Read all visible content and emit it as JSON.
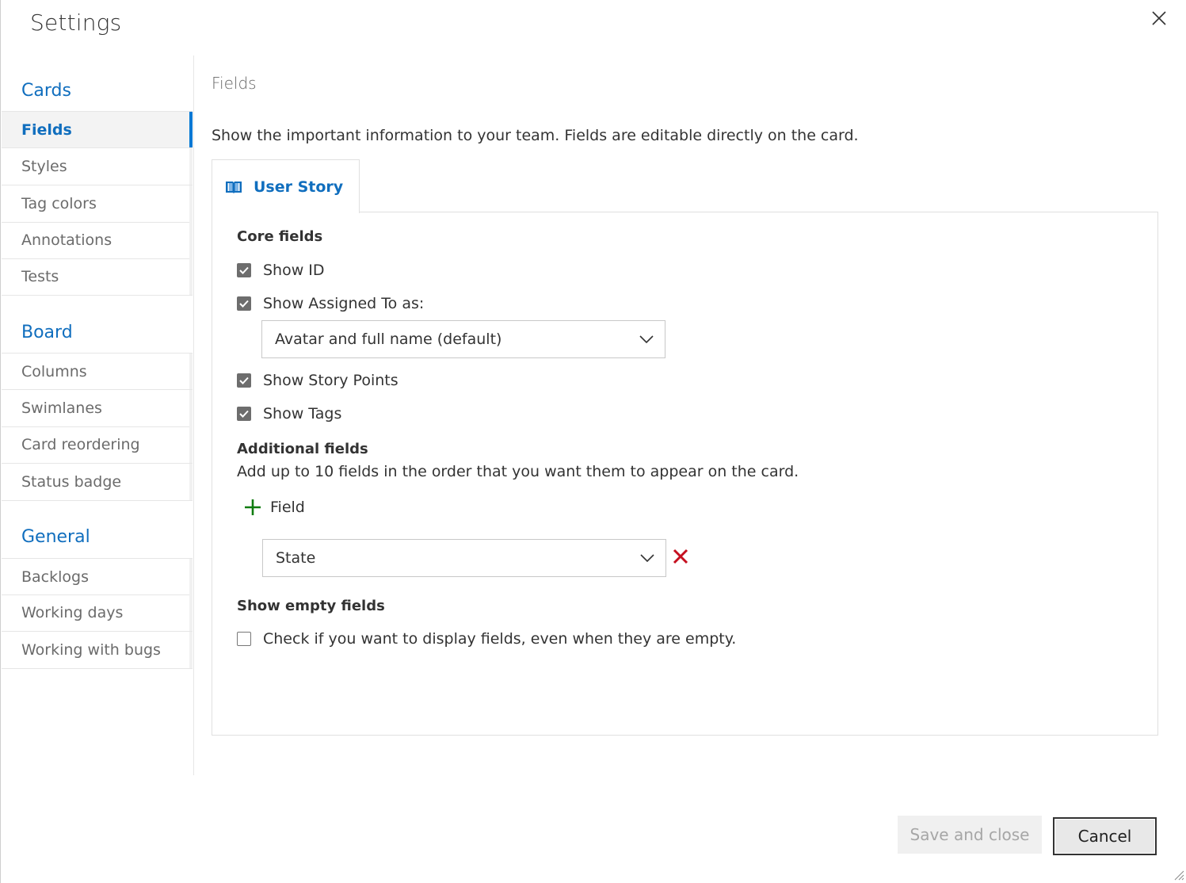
{
  "dialog": {
    "title": "Settings"
  },
  "sidebar": {
    "groups": [
      {
        "title": "Cards",
        "items": [
          "Fields",
          "Styles",
          "Tag colors",
          "Annotations",
          "Tests"
        ]
      },
      {
        "title": "Board",
        "items": [
          "Columns",
          "Swimlanes",
          "Card reordering",
          "Status badge"
        ]
      },
      {
        "title": "General",
        "items": [
          "Backlogs",
          "Working days",
          "Working with bugs"
        ]
      }
    ],
    "active_item": "Fields"
  },
  "main": {
    "section_title": "Fields",
    "description": "Show the important information to your team. Fields are editable directly on the card.",
    "tab": {
      "label": "User Story",
      "icon": "book-icon",
      "icon_color": "#106ebe"
    },
    "core_fields": {
      "heading": "Core fields",
      "show_id": {
        "label": "Show ID",
        "checked": true
      },
      "show_assigned": {
        "label": "Show Assigned To as:",
        "checked": true
      },
      "assigned_select": {
        "value": "Avatar and full name (default)"
      },
      "show_story_points": {
        "label": "Show Story Points",
        "checked": true
      },
      "show_tags": {
        "label": "Show Tags",
        "checked": true
      }
    },
    "additional_fields": {
      "heading": "Additional fields",
      "description": "Add up to 10 fields in the order that you want them to appear on the card.",
      "add_label": "Field",
      "fields": [
        {
          "value": "State"
        }
      ]
    },
    "empty_fields": {
      "heading": "Show empty fields",
      "label": "Check if you want to display fields, even when they are empty.",
      "checked": false
    }
  },
  "footer": {
    "save_label": "Save and close",
    "cancel_label": "Cancel"
  },
  "colors": {
    "accent": "#106ebe",
    "active_bar": "#0078d4",
    "add_green": "#107c10",
    "remove_red": "#c50f1f"
  }
}
